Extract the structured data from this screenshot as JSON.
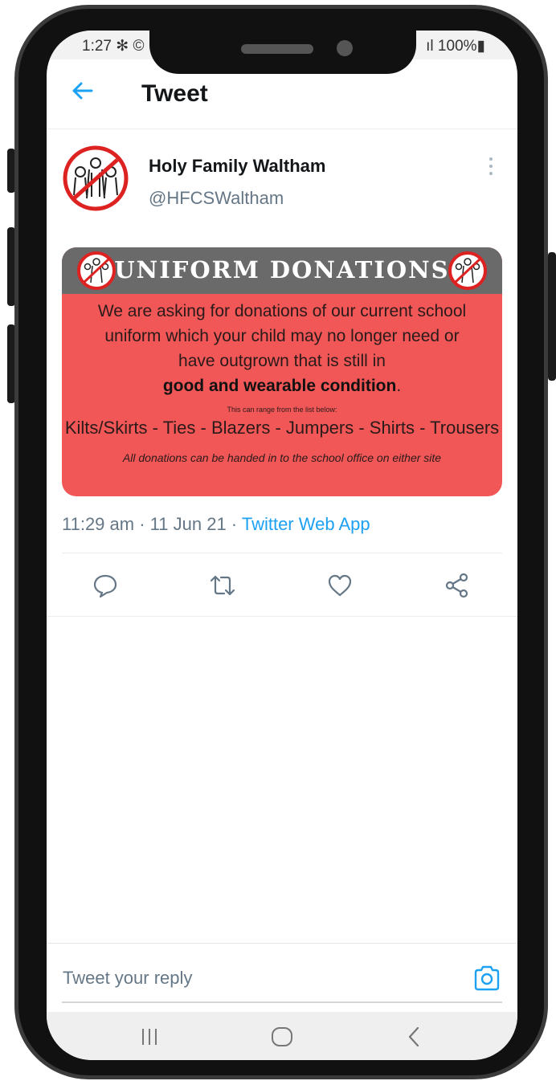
{
  "status_bar": {
    "time": "1:27 ✻ ©",
    "battery": "ıl 100%▮"
  },
  "header": {
    "title": "Tweet"
  },
  "tweet": {
    "author_name": "Holy Family Waltham",
    "author_handle": "@HFCSWaltham",
    "image": {
      "title": "UNIFORM DONATIONS",
      "line1": "We are asking for donations of our current school",
      "line2": "uniform which your child may no longer need or",
      "line3": "have outgrown that is still in",
      "line4_bold": "good and wearable condition",
      "line4_tail": ".",
      "small_note": "This can range from the list below:",
      "items": "Kilts/Skirts - Ties - Blazers - Jumpers - Shirts - Trousers",
      "footer": "All donations can be handed in to the school office on either site"
    },
    "time": "11:29 am",
    "sep1": " · ",
    "date": "11 Jun 21",
    "sep2": " · ",
    "source": "Twitter Web App"
  },
  "reply": {
    "placeholder": "Tweet your reply"
  },
  "colors": {
    "accent": "#1da1f2",
    "card_red": "#f25757",
    "card_header": "#6a6a6a",
    "text_primary": "#14171a",
    "text_secondary": "#657786"
  },
  "icons": [
    "back-arrow-icon",
    "more-vertical-icon",
    "reply-icon",
    "retweet-icon",
    "like-icon",
    "share-icon",
    "camera-icon",
    "recent-apps-icon",
    "home-icon",
    "back-icon"
  ]
}
